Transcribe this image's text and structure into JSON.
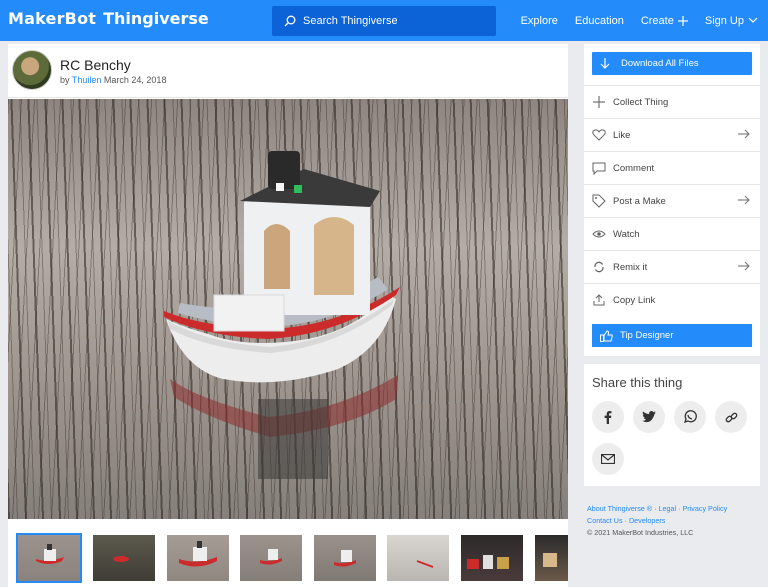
{
  "topbar": {
    "brand_maker": "MakerBot",
    "brand_thing": "Thingiverse",
    "search_placeholder": "Search Thingiverse",
    "nav": {
      "explore": "Explore",
      "education": "Education",
      "create": "Create",
      "signup": "Sign Up"
    }
  },
  "thing": {
    "title": "RC Benchy",
    "by": "by",
    "author": "Thuilen",
    "date": "March 24, 2018"
  },
  "actions": {
    "download": "Download All Files",
    "collect": "Collect Thing",
    "like": "Like",
    "comment": "Comment",
    "post_make": "Post a Make",
    "watch": "Watch",
    "remix": "Remix it",
    "copy_link": "Copy Link",
    "tip": "Tip Designer"
  },
  "share": {
    "title": "Share this thing",
    "buttons": [
      "facebook-icon",
      "twitter-icon",
      "whatsapp-icon",
      "link-icon",
      "email-icon"
    ]
  },
  "footer": {
    "about": "About Thingiverse ®",
    "sep1": " · ",
    "legal": "Legal",
    "sep2": " · ",
    "privacy": "Privacy Policy",
    "sep3": " · ",
    "contact": "Contact Us",
    "sep4": " · ",
    "developers": "Developers",
    "copyright": "© 2021 MakerBot Industries, LLC"
  },
  "colors": {
    "accent": "#248bfb",
    "search_bg": "#0c63d8"
  }
}
